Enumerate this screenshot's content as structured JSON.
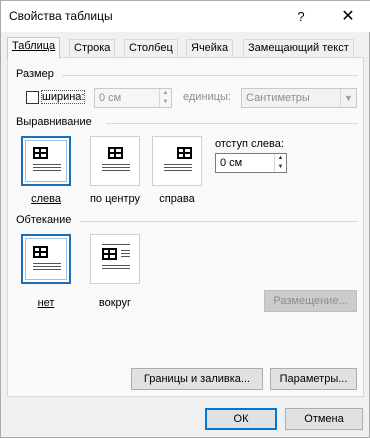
{
  "window": {
    "title": "Свойства таблицы",
    "help_label": "?",
    "close_label": "✕"
  },
  "tabs": [
    {
      "label": "Таблица",
      "active": true
    },
    {
      "label": "Строка",
      "active": false
    },
    {
      "label": "Столбец",
      "active": false
    },
    {
      "label": "Ячейка",
      "active": false
    },
    {
      "label": "Замещающий текст",
      "active": false
    }
  ],
  "size": {
    "heading": "Размер",
    "width_checkbox_label": "ширина:",
    "width_checked": false,
    "width_value": "0 см",
    "units_label": "единицы:",
    "units_value": "Сантиметры"
  },
  "alignment": {
    "heading": "Выравнивание",
    "options": [
      {
        "label": "слева",
        "selected": true
      },
      {
        "label": "по центру",
        "selected": false
      },
      {
        "label": "справа",
        "selected": false
      }
    ],
    "indent_label": "отступ слева:",
    "indent_value": "0 см"
  },
  "wrapping": {
    "heading": "Обтекание",
    "options": [
      {
        "label": "нет",
        "selected": true
      },
      {
        "label": "вокруг",
        "selected": false
      }
    ],
    "positioning_button": "Размещение..."
  },
  "buttons": {
    "borders": "Границы и заливка...",
    "options": "Параметры...",
    "ok": "ОК",
    "cancel": "Отмена"
  }
}
